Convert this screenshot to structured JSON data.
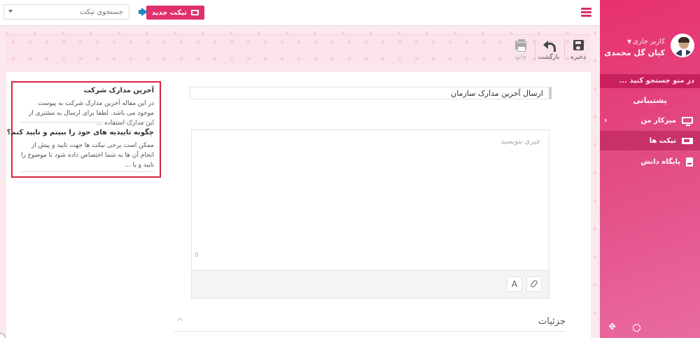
{
  "topbar": {
    "new_ticket_label": "تیکت جدید",
    "search_placeholder": "جستجوی تیکت"
  },
  "sidebar": {
    "user_role": "کاربر جاری",
    "user_name": "کیان گل محمدی",
    "search_text": "در منو جستجو کنید ...",
    "section_heading": "پشتیبانی",
    "items": [
      {
        "label": "میزکار من",
        "icon": "monitor-icon"
      },
      {
        "label": "تیکت ها",
        "icon": "ticket-icon"
      },
      {
        "label": "پایگاه دانش",
        "icon": "book-icon"
      }
    ]
  },
  "toolbar": {
    "save_label": "ذخیره",
    "back_label": "بازگشت",
    "print_label": "چاپ"
  },
  "form": {
    "subject_value": "ارسال آخرین مدارک سازمان",
    "editor_placeholder": "چیزی بنویسید",
    "char_count": "0",
    "font_button": "A",
    "details_title": "جزئیات"
  },
  "knowledge_base": {
    "articles": [
      {
        "title": "آخرین مدارک شرکت",
        "text": "در این مقاله آخرین مدارک شرکت به پیوست موجود می باشد. لطفا برای ارسال به مشتری از این مدارک استفاده ..."
      },
      {
        "title": "چگونه تاییدیه های خود را ببینم و تایید کنم؟",
        "text": "ممکن است برخی تیکت ها جهت تایید و پیش از انجام آن ها به شما اختصاص داده شود تا موضوع را تایید و یا ..."
      }
    ]
  },
  "colors": {
    "accent": "#e0306e",
    "sidebar_top": "#e8306f",
    "highlight_border": "#d9243b",
    "megaphone": "#1e88c7"
  }
}
